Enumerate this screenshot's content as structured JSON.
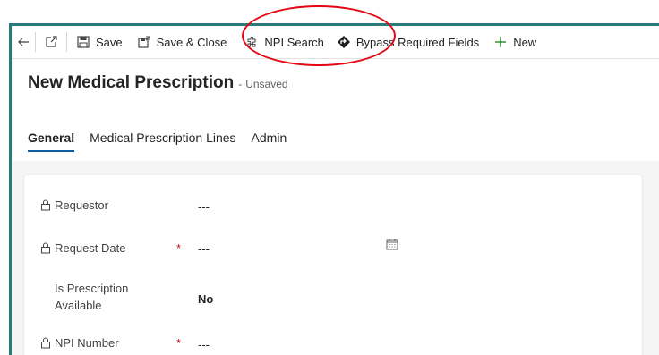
{
  "toolbar": {
    "save_label": "Save",
    "save_close_label": "Save & Close",
    "npi_search_label": "NPI Search",
    "bypass_label": "Bypass Required Fields",
    "new_label": "New"
  },
  "header": {
    "title": "New Medical Prescription",
    "separator": "-",
    "status": "Unsaved"
  },
  "tabs": [
    {
      "label": "General",
      "active": true
    },
    {
      "label": "Medical Prescription Lines",
      "active": false
    },
    {
      "label": "Admin",
      "active": false
    }
  ],
  "form": {
    "requestor": {
      "label": "Requestor",
      "value": "---"
    },
    "request_date": {
      "label": "Request Date",
      "required_mark": "*",
      "value": "---"
    },
    "is_prescription": {
      "label_line1": "Is Prescription",
      "label_line2": "Available",
      "value": "No"
    },
    "npi_number": {
      "label": "NPI Number",
      "required_mark": "*",
      "value": "---"
    }
  },
  "colors": {
    "accent": "#115ea3",
    "frame": "#2b7a7a",
    "annotation": "#e30613",
    "required": "#c50f1f",
    "new_plus": "#107c10"
  },
  "icons": [
    "back-arrow-icon",
    "open-new-window-icon",
    "save-icon",
    "save-close-icon",
    "puzzle-icon",
    "bypass-diamond-icon",
    "plus-icon",
    "lock-icon",
    "calendar-icon"
  ]
}
